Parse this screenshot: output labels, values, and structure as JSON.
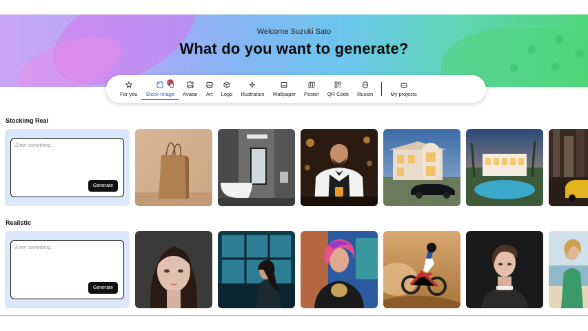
{
  "hero": {
    "welcome": "Welcome Suzuki Sato",
    "headline": "What do you want to generate?"
  },
  "nav": {
    "items": [
      {
        "label": "For you",
        "icon": "star-icon"
      },
      {
        "label": "Stock Image",
        "icon": "stock-image-icon",
        "active": true
      },
      {
        "label": "Avatar",
        "icon": "avatar-icon"
      },
      {
        "label": "Art",
        "icon": "art-icon"
      },
      {
        "label": "Logo",
        "icon": "logo-icon"
      },
      {
        "label": "Illustration",
        "icon": "sparkle-icon"
      },
      {
        "label": "Wallpaper",
        "icon": "wallpaper-icon"
      },
      {
        "label": "Poster",
        "icon": "poster-icon"
      },
      {
        "label": "QR Code",
        "icon": "qr-code-icon"
      },
      {
        "label": "Illusion",
        "icon": "illusion-icon"
      }
    ],
    "projects": {
      "label": "My projects",
      "icon": "projects-icon"
    },
    "active_color": "#1f62d6"
  },
  "sections": [
    {
      "title": "Stockimg Real",
      "prompt": {
        "placeholder": "Enter something...",
        "button": "Generate"
      },
      "thumbnails": [
        "paper-bag",
        "bathroom",
        "bartender",
        "mansion-car",
        "villa-pool",
        "city-taxi"
      ]
    },
    {
      "title": "Realistic",
      "prompt": {
        "placeholder": "Enter something...",
        "button": "Generate"
      },
      "thumbnails": [
        "portrait-woman",
        "woman-window",
        "pink-hair-woman",
        "motocross",
        "short-hair-woman",
        "beach-woman"
      ]
    }
  ],
  "colors": {
    "prompt_card_bg": "#dbe8fb",
    "button_bg": "#111111"
  }
}
